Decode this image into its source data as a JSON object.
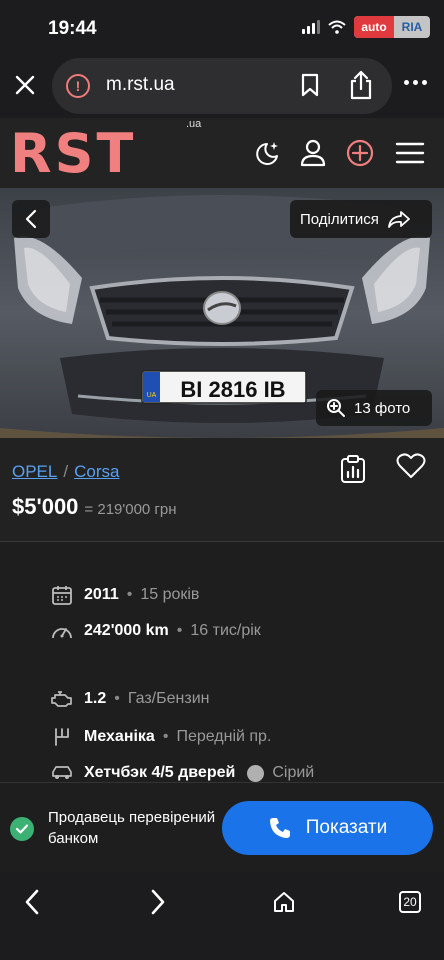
{
  "status_bar": {
    "time": "19:44",
    "badge": {
      "part1": "auto",
      "part2": "RIA"
    }
  },
  "browser": {
    "url": "m.rst.ua",
    "tabs_count": "20"
  },
  "site": {
    "logo": "RST",
    "logo_suffix": ".ua"
  },
  "hero": {
    "share_label": "Поділитися",
    "photos_label": "13 фото",
    "plate": "BI 2816 IB",
    "plate_country": "UA"
  },
  "listing": {
    "brand": "OPEL",
    "separator": "/",
    "model": "Corsa",
    "price_usd": "$5'000",
    "price_uah": "= 219'000 грн"
  },
  "specs": {
    "year": "2011",
    "age": "15 років",
    "mileage": "242'000 km",
    "mileage_per_year": "16 тис/рік",
    "engine": "1.2",
    "fuel": "Газ/Бензин",
    "gearbox": "Механіка",
    "drive": "Передній пр.",
    "body": "Хетчбэк 4/5 дверей",
    "color": "Сірий",
    "dot": "•"
  },
  "contact": {
    "verified_text": "Продавець перевірений банком",
    "show_label": "Показати"
  },
  "colors": {
    "brand_logo": "#f07f7f",
    "link": "#5aa0f0",
    "primary_button": "#1a73e8",
    "verified": "#3bb273"
  }
}
